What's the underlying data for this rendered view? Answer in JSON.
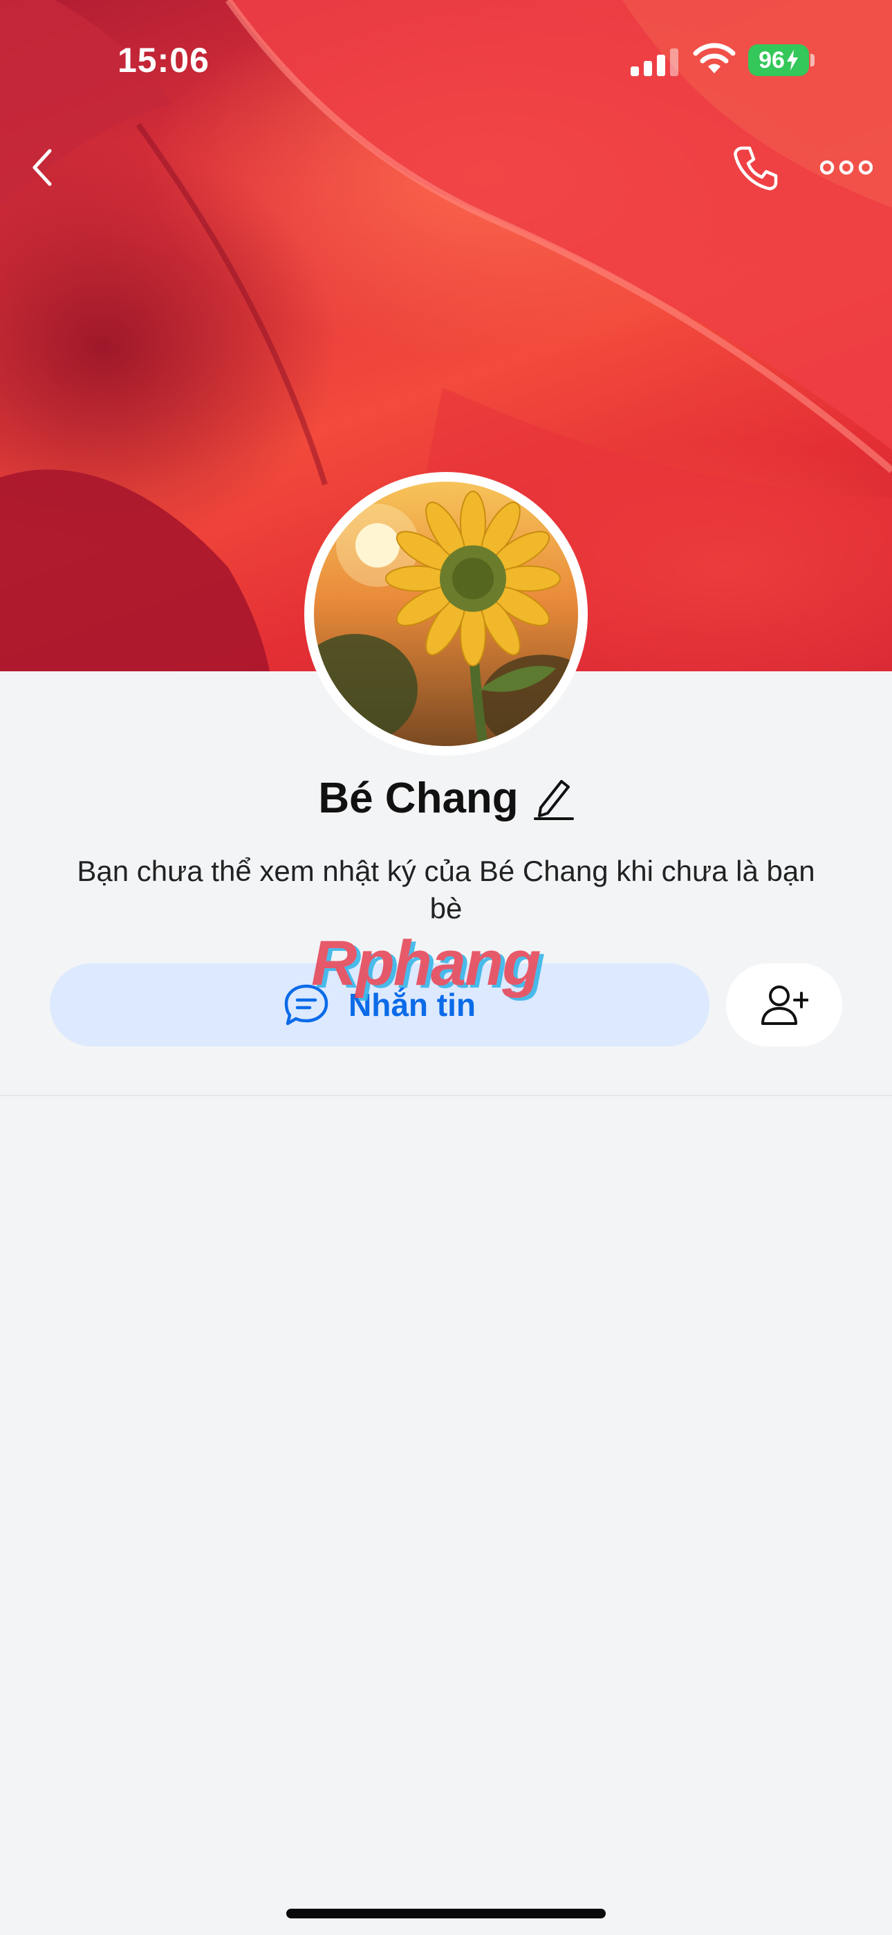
{
  "status_bar": {
    "time": "15:06",
    "battery": "96",
    "icons": [
      "signal-icon",
      "wifi-icon",
      "battery-icon",
      "charging-bolt-icon"
    ]
  },
  "nav": {
    "icons": [
      "back-chevron-icon",
      "phone-icon",
      "more-dots-icon"
    ]
  },
  "profile": {
    "name": "Bé Chang",
    "notice": "Bạn chưa thể xem nhật ký của Bé Chang khi chưa là bạn bè",
    "cover_image": "red rose petals",
    "avatar_image": "sunflower at sunset"
  },
  "watermark": "Rphang",
  "actions": {
    "message_label": "Nhắn tin",
    "message_icon": "chat-bubble-icon",
    "add_friend_icon": "add-friend-icon"
  },
  "colors": {
    "accent": "#0b6be8",
    "button_bg": "#dce9fe",
    "page_bg": "#f3f4f6",
    "battery": "#34c759"
  }
}
